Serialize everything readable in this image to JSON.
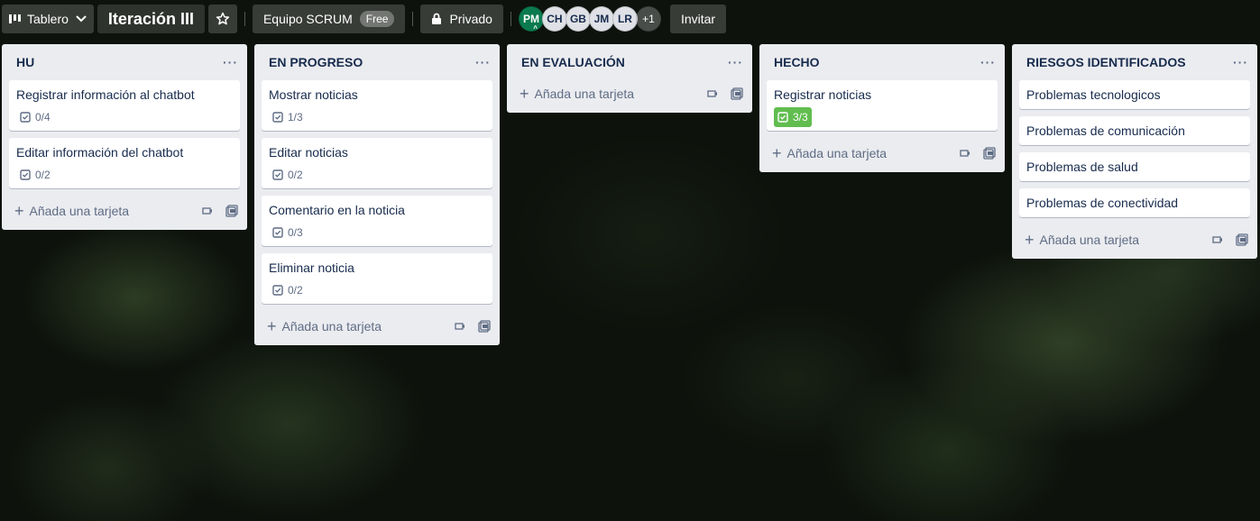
{
  "topbar": {
    "board_menu_label": "Tablero",
    "board_title": "Iteración III",
    "workspace_label": "Equipo SCRUM",
    "workspace_badge": "Free",
    "visibility_label": "Privado",
    "members": [
      "PM",
      "CH",
      "GB",
      "JM",
      "LR"
    ],
    "members_more": "+1",
    "invite_label": "Invitar"
  },
  "add_card_label": "Añada una tarjeta",
  "lists": [
    {
      "title": "HU",
      "cards": [
        {
          "title": "Registrar información al chatbot",
          "checklist": "0/4"
        },
        {
          "title": "Editar información del chatbot",
          "checklist": "0/2"
        }
      ]
    },
    {
      "title": "EN PROGRESO",
      "cards": [
        {
          "title": "Mostrar noticias",
          "checklist": "1/3"
        },
        {
          "title": "Editar noticias",
          "checklist": "0/2"
        },
        {
          "title": "Comentario en la noticia",
          "checklist": "0/3"
        },
        {
          "title": "Eliminar noticia",
          "checklist": "0/2"
        }
      ]
    },
    {
      "title": "EN EVALUACIÓN",
      "cards": []
    },
    {
      "title": "HECHO",
      "cards": [
        {
          "title": "Registrar noticias",
          "checklist": "3/3",
          "complete": true
        }
      ]
    },
    {
      "title": "RIESGOS IDENTIFICADOS",
      "cards": [
        {
          "title": "Problemas tecnologicos"
        },
        {
          "title": "Problemas de comunicación"
        },
        {
          "title": "Problemas de salud"
        },
        {
          "title": "Problemas de conectividad"
        }
      ]
    }
  ],
  "colors": {
    "list_bg": "#ebecf0",
    "done_badge": "#61bd4f",
    "owner_avatar": "#0b7a4f"
  },
  "icons": [
    "board-icon",
    "chevron-down-icon",
    "star-icon",
    "lock-icon",
    "checklist-icon",
    "plus-icon",
    "template-icon",
    "card-template-icon",
    "list-menu-icon"
  ]
}
